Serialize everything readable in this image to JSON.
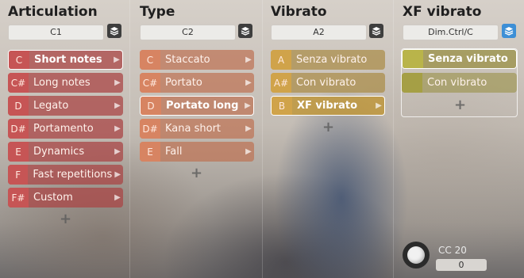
{
  "columns": {
    "articulation": {
      "title": "Articulation",
      "selector": "C1",
      "items": [
        {
          "key": "C",
          "label": "Short notes"
        },
        {
          "key": "C#",
          "label": "Long notes"
        },
        {
          "key": "D",
          "label": "Legato"
        },
        {
          "key": "D#",
          "label": "Portamento"
        },
        {
          "key": "E",
          "label": "Dynamics"
        },
        {
          "key": "F",
          "label": "Fast repetitions"
        },
        {
          "key": "F#",
          "label": "Custom"
        }
      ]
    },
    "type": {
      "title": "Type",
      "selector": "C2",
      "items": [
        {
          "key": "C",
          "label": "Staccato"
        },
        {
          "key": "C#",
          "label": "Portato"
        },
        {
          "key": "D",
          "label": "Portato long"
        },
        {
          "key": "D#",
          "label": "Kana short"
        },
        {
          "key": "E",
          "label": "Fall"
        }
      ]
    },
    "vibrato": {
      "title": "Vibrato",
      "selector": "A2",
      "items": [
        {
          "key": "A",
          "label": "Senza vibrato"
        },
        {
          "key": "A#",
          "label": "Con vibrato"
        },
        {
          "key": "B",
          "label": "XF vibrato"
        }
      ]
    },
    "xf_vibrato": {
      "title": "XF vibrato",
      "selector": "Dim.Ctrl/C",
      "items": [
        {
          "label": "Senza vibrato"
        },
        {
          "label": "Con vibrato"
        }
      ]
    }
  },
  "controller": {
    "label": "CC 20",
    "value": "0"
  },
  "add_symbol": "+",
  "icons": {
    "layers": "layers-icon",
    "arrow": "chevron-right-icon",
    "add": "plus-icon",
    "knob": "knob-icon"
  },
  "colors": {
    "articulation": "#c65555",
    "type": "#d78462",
    "vibrato": "#d0a34a",
    "xf_vibrato": "#b9b44a",
    "active_layer": "#3d8fd6"
  }
}
